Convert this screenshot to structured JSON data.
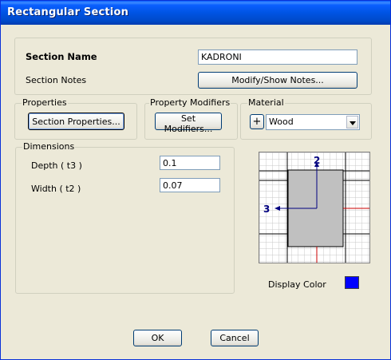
{
  "window": {
    "title": "Rectangular Section"
  },
  "section": {
    "name_label": "Section Name",
    "name_value": "KADRONI",
    "notes_label": "Section Notes",
    "notes_button": "Modify/Show Notes..."
  },
  "properties": {
    "legend": "Properties",
    "button": "Section Properties..."
  },
  "modifiers": {
    "legend": "Property Modifiers",
    "button": "Set Modifiers..."
  },
  "material": {
    "legend": "Material",
    "add_button": "+",
    "selected": "Wood"
  },
  "dimensions": {
    "legend": "Dimensions",
    "depth_label": "Depth  ( t3 )",
    "depth_value": "0.1",
    "width_label": "Width  ( t2 )",
    "width_value": "0.07"
  },
  "preview": {
    "axis2_label": "2",
    "axis3_label": "3",
    "fill_color": "#c0c0c0",
    "axis_color": "#000080"
  },
  "display_color": {
    "label": "Display Color",
    "color": "#0000ff"
  },
  "footer": {
    "ok": "OK",
    "cancel": "Cancel"
  }
}
